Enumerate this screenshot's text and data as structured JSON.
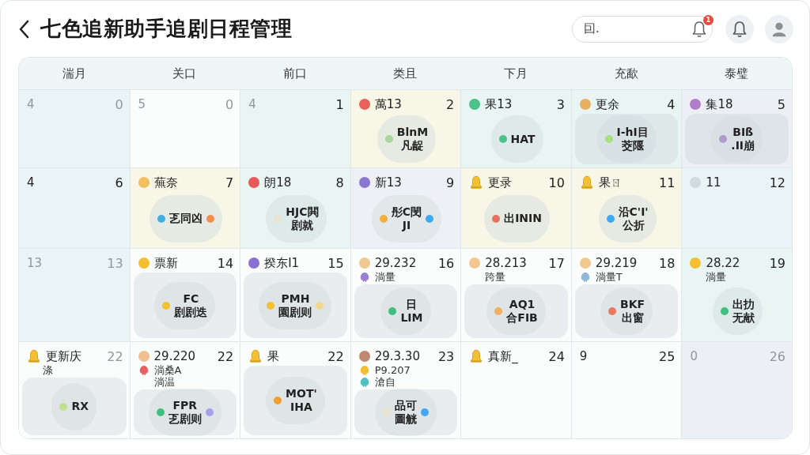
{
  "header": {
    "title": "七色追新助手追剧日程管理",
    "search": {
      "value": "囙."
    },
    "notification_badge": "1"
  },
  "weekdays": [
    "湍月",
    "关口",
    "前口",
    "类且",
    "下月",
    "充歃",
    "泰璧"
  ],
  "weeks": [
    [
      {
        "color": "#eaf3f6",
        "marker": {
          "kind": "none"
        },
        "label": "4",
        "label_muted": true,
        "day": "0",
        "day_muted": true
      },
      {
        "color": "#fbfcfc",
        "marker": {
          "kind": "none"
        },
        "label": "5",
        "label_muted": true,
        "day": "0",
        "day_muted": true
      },
      {
        "color": "#e8f5f3",
        "marker": {
          "kind": "none"
        },
        "label": "4",
        "label_muted": true,
        "day": "1",
        "day_muted": false
      },
      {
        "color": "#f8f6e6",
        "marker": {
          "kind": "dot",
          "color": "#e8625a"
        },
        "label": "萬13",
        "label_muted": false,
        "day": "2",
        "day_muted": false,
        "bubble": {
          "lines": [
            "BlnM",
            "凡龊"
          ],
          "dots": [
            {
              "color": "#a8d89a"
            }
          ]
        }
      },
      {
        "color": "#e8f5f3",
        "marker": {
          "kind": "dot",
          "color": "#4cc28a"
        },
        "label": "果13",
        "label_muted": false,
        "day": "3",
        "day_muted": false,
        "bubble": {
          "lines": [
            "HAT"
          ],
          "dots": [
            {
              "color": "#4cc28a"
            }
          ]
        }
      },
      {
        "color": "#e8f5f3",
        "marker": {
          "kind": "dot",
          "color": "#e8b060"
        },
        "label": "更余",
        "label_muted": false,
        "day": "4",
        "day_muted": false,
        "panel": true,
        "bubble": {
          "lines": [
            "I-hI目",
            "茭隁"
          ],
          "dots": [
            {
              "color": "#a8e080"
            }
          ]
        }
      },
      {
        "color": "#eceff3",
        "marker": {
          "kind": "dot",
          "color": "#b07ec8"
        },
        "label": "集18",
        "label_muted": false,
        "day": "5",
        "day_muted": false,
        "panel": true,
        "bubble": {
          "lines": [
            "BIß",
            ".II崩"
          ],
          "dots": [
            {
              "color": "#b09ad0"
            }
          ]
        }
      }
    ],
    [
      {
        "color": "#eaf3f6",
        "marker": {
          "kind": "none"
        },
        "label": "4",
        "label_muted": false,
        "day": "6",
        "day_muted": false
      },
      {
        "color": "#f8f6e6",
        "marker": {
          "kind": "dot",
          "color": "#f0c060"
        },
        "label": "蕪奈",
        "label_muted": false,
        "day": "7",
        "day_muted": false,
        "bubble": {
          "lines": [
            "乤同凶"
          ],
          "dots": [
            {
              "color": "#40b0e0"
            },
            {
              "color": "#f09050"
            }
          ]
        }
      },
      {
        "color": "#e8f5f3",
        "marker": {
          "kind": "dot",
          "color": "#e85858"
        },
        "label": "朗18",
        "label_muted": false,
        "day": "8",
        "day_muted": false,
        "bubble": {
          "lines": [
            "HJC閧",
            "剧就"
          ],
          "dots": [
            {
              "color": "#e8e4d0"
            }
          ]
        }
      },
      {
        "color": "#eef0f5",
        "marker": {
          "kind": "dot",
          "color": "#8a78d0"
        },
        "label": "新13",
        "label_muted": false,
        "day": "9",
        "day_muted": false,
        "bubble": {
          "lines": [
            "彤C閔",
            "JI"
          ],
          "dots": [
            {
              "color": "#f0b040"
            },
            {
              "color": "#40a8f0"
            }
          ]
        }
      },
      {
        "color": "#f8f6e6",
        "marker": {
          "kind": "bell"
        },
        "label": "更录",
        "label_muted": false,
        "day": "10",
        "day_muted": false,
        "bubble": {
          "lines": [
            "出ININ"
          ],
          "dots": [
            {
              "color": "#e87060"
            }
          ]
        }
      },
      {
        "color": "#f8f6e6",
        "marker": {
          "kind": "bell"
        },
        "label": "果ㄖ",
        "label_muted": false,
        "day": "11",
        "day_muted": false,
        "bubble": {
          "lines": [
            "沿C'I'",
            "公折"
          ],
          "dots": [
            {
              "color": "#40a8f0"
            }
          ]
        }
      },
      {
        "color": "#eaf3f6",
        "marker": {
          "kind": "dot",
          "color": "#d0dae0"
        },
        "label": "11",
        "label_muted": false,
        "day": "12",
        "day_muted": false
      }
    ],
    [
      {
        "color": "#eaf3f6",
        "marker": {
          "kind": "none"
        },
        "label": "13",
        "label_muted": true,
        "day": "13",
        "day_muted": true
      },
      {
        "color": "#fbfcfc",
        "marker": {
          "kind": "dot",
          "color": "#f5c030"
        },
        "label": "票新",
        "label_muted": false,
        "day": "14",
        "day_muted": false,
        "panel": true,
        "bubble": {
          "lines": [
            "FC",
            "剧剧迭"
          ],
          "dots": [
            {
              "color": "#f5c030"
            }
          ]
        }
      },
      {
        "color": "#fbfcfc",
        "marker": {
          "kind": "dot",
          "color": "#8a70d0"
        },
        "label": "揆东I1",
        "label_muted": false,
        "day": "15",
        "day_muted": false,
        "panel": true,
        "bubble": {
          "lines": [
            "PMH",
            "園剧则"
          ],
          "dots": [
            {
              "color": "#f5c030"
            },
            {
              "color": "#f0d890"
            }
          ]
        }
      },
      {
        "color": "#fbfcfc",
        "marker": {
          "kind": "dot",
          "color": "#f0c890"
        },
        "label": "29.232",
        "label_muted": false,
        "day": "16",
        "day_muted": false,
        "subs": [
          {
            "kind": "flower",
            "color": "#9a80d0",
            "text": "淌量"
          }
        ],
        "panel": true,
        "bubble": {
          "lines": [
            "日",
            "LIM"
          ],
          "dots": [
            {
              "color": "#40c080"
            }
          ]
        }
      },
      {
        "color": "#fbfcfc",
        "marker": {
          "kind": "dot",
          "color": "#f0c890"
        },
        "label": "28.213",
        "label_muted": false,
        "day": "17",
        "day_muted": false,
        "subs": [
          {
            "kind": "plain",
            "text": "跨量"
          }
        ],
        "panel": true,
        "bubble": {
          "lines": [
            "AQ1",
            "合FIB"
          ],
          "dots": [
            {
              "color": "#f0b060"
            }
          ]
        }
      },
      {
        "color": "#fbfcfc",
        "marker": {
          "kind": "dot",
          "color": "#f0c890"
        },
        "label": "29.219",
        "label_muted": false,
        "day": "18",
        "day_muted": false,
        "subs": [
          {
            "kind": "flower",
            "color": "#90b8d8",
            "text": "淌量T"
          }
        ],
        "panel": true,
        "bubble": {
          "lines": [
            "BKF",
            "出窗"
          ],
          "dots": [
            {
              "color": "#e87860"
            }
          ]
        }
      },
      {
        "color": "#e8f5f3",
        "marker": {
          "kind": "dot",
          "color": "#f5c030"
        },
        "label": "28.22",
        "label_muted": false,
        "day": "19",
        "day_muted": false,
        "subs": [
          {
            "kind": "plain",
            "text": "淌量"
          }
        ],
        "bubble": {
          "lines": [
            "出扐",
            "无献"
          ],
          "dots": [
            {
              "color": "#40c080"
            }
          ]
        }
      }
    ],
    [
      {
        "color": "#fbfcfc",
        "marker": {
          "kind": "bell"
        },
        "label": "更新庆",
        "label_muted": false,
        "day": "22",
        "day_muted": true,
        "subs": [
          {
            "kind": "plain",
            "text": "涤"
          }
        ],
        "panel": true,
        "bubble": {
          "lines": [
            "RX"
          ],
          "dots": [
            {
              "color": "#c0e090"
            }
          ]
        }
      },
      {
        "color": "#fbfcfc",
        "marker": {
          "kind": "dot",
          "color": "#f0c090"
        },
        "label": "29.220",
        "label_muted": false,
        "day": "22",
        "day_muted": false,
        "subs": [
          {
            "kind": "flower",
            "color": "#e86060",
            "text": "淌桑A"
          },
          {
            "kind": "plain",
            "text": "淌温"
          }
        ],
        "panel": true,
        "bubble": {
          "lines": [
            "FPR",
            "乤剧则"
          ],
          "dots": [
            {
              "color": "#40c080"
            },
            {
              "color": "#a8a0e8"
            }
          ]
        }
      },
      {
        "color": "#fbfcfc",
        "marker": {
          "kind": "bell"
        },
        "label": "果",
        "label_muted": false,
        "day": "22",
        "day_muted": false,
        "panel": true,
        "bubble": {
          "lines": [
            "MOT'",
            "IHA"
          ],
          "dots": [
            {
              "color": "#f0a030"
            }
          ]
        }
      },
      {
        "color": "#fbfcfc",
        "marker": {
          "kind": "dot",
          "color": "#c08870"
        },
        "label": "29.3.30",
        "label_muted": false,
        "day": "23",
        "day_muted": false,
        "subs": [
          {
            "kind": "flower",
            "color": "#f0c030",
            "text": "P9.207"
          },
          {
            "kind": "flower",
            "color": "#50c0c0",
            "text": "滄自"
          }
        ],
        "panel": true,
        "bubble": {
          "lines": [
            "品可",
            "圖觥"
          ],
          "dots": [
            {
              "color": "#e8e4d0"
            },
            {
              "color": "#40a8f0"
            }
          ]
        }
      },
      {
        "color": "#fbfcfc",
        "marker": {
          "kind": "bell"
        },
        "label": "真新_",
        "label_muted": false,
        "day": "24",
        "day_muted": false
      },
      {
        "color": "#fbfcfc",
        "marker": {
          "kind": "none"
        },
        "label": "9",
        "label_muted": false,
        "day": "25",
        "day_muted": false
      },
      {
        "color": "#eceff3",
        "marker": {
          "kind": "none"
        },
        "label": "0",
        "label_muted": true,
        "day": "26",
        "day_muted": true
      }
    ]
  ]
}
